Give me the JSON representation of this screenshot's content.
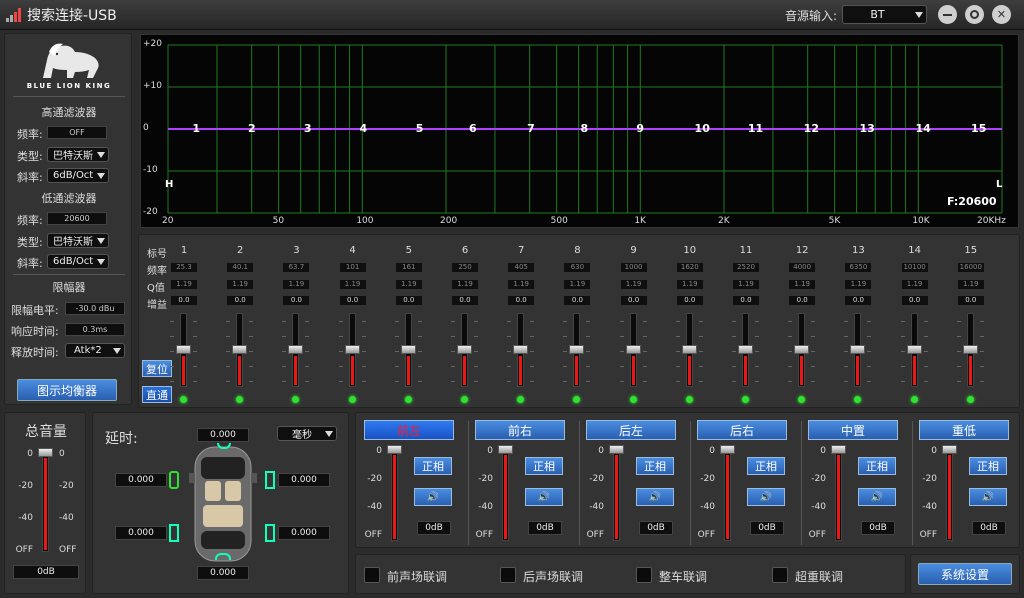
{
  "window": {
    "title": "搜索连接-USB",
    "source_label": "音源输入:",
    "source_value": "BT",
    "colors": {
      "accent": "#2a6fd6",
      "eq_line": "#b040ff",
      "grid": "#1e7a1e",
      "fader_fill": "#e61818",
      "led": "#2ee22e"
    }
  },
  "brand": {
    "name": "BLUE LION KING"
  },
  "highpass": {
    "title": "高通滤波器",
    "freq_label": "频率:",
    "freq_value": "OFF",
    "type_label": "类型:",
    "type_value": "巴特沃斯",
    "slope_label": "斜率:",
    "slope_value": "6dB/Oct"
  },
  "lowpass": {
    "title": "低通滤波器",
    "freq_label": "频率:",
    "freq_value": "20600",
    "type_label": "类型:",
    "type_value": "巴特沃斯",
    "slope_label": "斜率:",
    "slope_value": "6dB/Oct"
  },
  "limiter": {
    "title": "限幅器",
    "level_label": "限幅电平:",
    "level_value": "-30.0 dBu",
    "attack_label": "响应时间:",
    "attack_value": "0.3ms",
    "release_label": "释放时间:",
    "release_value": "Atk*2"
  },
  "graphic_eq_button": "图示均衡器",
  "eq_graph": {
    "y_ticks": [
      "+20",
      "+10",
      "0",
      "-10",
      "-20"
    ],
    "x_ticks": [
      "20",
      "50",
      "100",
      "200",
      "500",
      "1K",
      "2K",
      "5K",
      "10K",
      "20KHz"
    ],
    "hp_marker": "H",
    "lp_marker": "L",
    "freq_readout": "F:20600"
  },
  "chart_data": {
    "type": "line",
    "x_scale": "log",
    "xlim": [
      20,
      20000
    ],
    "ylim": [
      -20,
      20
    ],
    "x": [
      25.3,
      40.1,
      63.7,
      101,
      161,
      250,
      405,
      630,
      1000,
      1620,
      2520,
      4000,
      6350,
      10100,
      16000
    ],
    "y": [
      0,
      0,
      0,
      0,
      0,
      0,
      0,
      0,
      0,
      0,
      0,
      0,
      0,
      0,
      0
    ],
    "point_labels": [
      "1",
      "2",
      "3",
      "4",
      "5",
      "6",
      "7",
      "8",
      "9",
      "10",
      "11",
      "12",
      "13",
      "14",
      "15"
    ],
    "grid": true
  },
  "bands": {
    "label_band": "标号",
    "label_freq": "频率",
    "label_q": "Q值",
    "label_gain": "增益",
    "reset_button": "复位",
    "bypass_button": "直通",
    "items": [
      {
        "n": "1",
        "freq": "25.3",
        "q": "1.19",
        "gain": "0.0",
        "level": 0.5
      },
      {
        "n": "2",
        "freq": "40.1",
        "q": "1.19",
        "gain": "0.0",
        "level": 0.5
      },
      {
        "n": "3",
        "freq": "63.7",
        "q": "1.19",
        "gain": "0.0",
        "level": 0.5
      },
      {
        "n": "4",
        "freq": "101",
        "q": "1.19",
        "gain": "0.0",
        "level": 0.5
      },
      {
        "n": "5",
        "freq": "161",
        "q": "1.19",
        "gain": "0.0",
        "level": 0.5
      },
      {
        "n": "6",
        "freq": "250",
        "q": "1.19",
        "gain": "0.0",
        "level": 0.5
      },
      {
        "n": "7",
        "freq": "405",
        "q": "1.19",
        "gain": "0.0",
        "level": 0.5
      },
      {
        "n": "8",
        "freq": "630",
        "q": "1.19",
        "gain": "0.0",
        "level": 0.5
      },
      {
        "n": "9",
        "freq": "1000",
        "q": "1.19",
        "gain": "0.0",
        "level": 0.5
      },
      {
        "n": "10",
        "freq": "1620",
        "q": "1.19",
        "gain": "0.0",
        "level": 0.5
      },
      {
        "n": "11",
        "freq": "2520",
        "q": "1.19",
        "gain": "0.0",
        "level": 0.5
      },
      {
        "n": "12",
        "freq": "4000",
        "q": "1.19",
        "gain": "0.0",
        "level": 0.5
      },
      {
        "n": "13",
        "freq": "6350",
        "q": "1.19",
        "gain": "0.0",
        "level": 0.5
      },
      {
        "n": "14",
        "freq": "10100",
        "q": "1.19",
        "gain": "0.0",
        "level": 0.5
      },
      {
        "n": "15",
        "freq": "16000",
        "q": "1.19",
        "gain": "0.0",
        "level": 0.5
      }
    ]
  },
  "master": {
    "title": "总音量",
    "scale": [
      "0",
      "-20",
      "-40",
      "OFF"
    ],
    "value": "0dB",
    "level": 1.0
  },
  "delay": {
    "title": "延时:",
    "unit": "毫秒",
    "top": "0.000",
    "left_front": "0.000",
    "right_front": "0.000",
    "left_rear": "0.000",
    "right_rear": "0.000",
    "bottom": "0.000"
  },
  "channels": {
    "scale": [
      "0",
      "-20",
      "-40",
      "OFF"
    ],
    "items": [
      {
        "name": "前左",
        "phase": "正相",
        "value": "0dB",
        "level": 1.0,
        "selected": true
      },
      {
        "name": "前右",
        "phase": "正相",
        "value": "0dB",
        "level": 1.0,
        "selected": false
      },
      {
        "name": "后左",
        "phase": "正相",
        "value": "0dB",
        "level": 1.0,
        "selected": false
      },
      {
        "name": "后右",
        "phase": "正相",
        "value": "0dB",
        "level": 1.0,
        "selected": false
      },
      {
        "name": "中置",
        "phase": "正相",
        "value": "0dB",
        "level": 1.0,
        "selected": false
      },
      {
        "name": "重低",
        "phase": "正相",
        "value": "0dB",
        "level": 1.0,
        "selected": false
      }
    ]
  },
  "links": [
    {
      "label": "前声场联调"
    },
    {
      "label": "后声场联调"
    },
    {
      "label": "整车联调"
    },
    {
      "label": "超重联调"
    }
  ],
  "system_settings_button": "系统设置"
}
